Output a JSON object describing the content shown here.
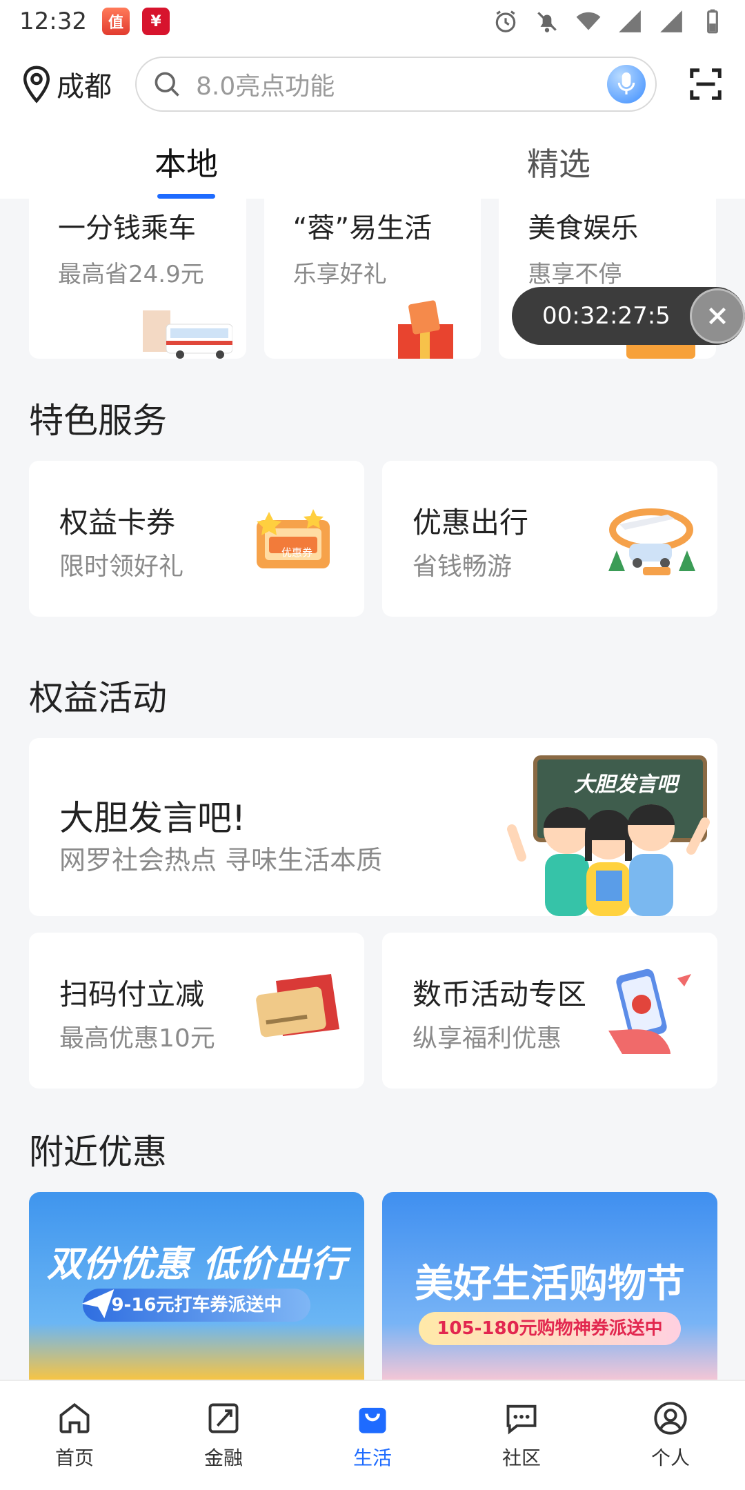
{
  "status_bar": {
    "time": "12:32",
    "app_badges": [
      "值",
      "¥"
    ]
  },
  "header": {
    "city": "成都",
    "search_placeholder": "8.0亮点功能"
  },
  "tabs": [
    {
      "label": "本地",
      "active": true
    },
    {
      "label": "精选",
      "active": false
    }
  ],
  "top_cards": [
    {
      "title": "一分钱乘车",
      "subtitle": "最高省24.9元"
    },
    {
      "title": "“蓉”易生活",
      "subtitle": "乐享好礼"
    },
    {
      "title": "美食娱乐",
      "subtitle": "惠享不停"
    }
  ],
  "timer": {
    "text": "00:32:27:5"
  },
  "special_services": {
    "title": "特色服务",
    "items": [
      {
        "title": "权益卡券",
        "subtitle": "限时领好礼",
        "art_label": "优惠券"
      },
      {
        "title": "优惠出行",
        "subtitle": "省钱畅游"
      }
    ]
  },
  "benefit_activities": {
    "title": "权益活动",
    "feature": {
      "title": "大胆发言吧!",
      "subtitle": "网罗社会热点 寻味生活本质",
      "art_label": "大胆发言吧"
    },
    "items": [
      {
        "title": "扫码付立减",
        "subtitle": "最高优惠10元"
      },
      {
        "title": "数币活动专区",
        "subtitle": "纵享福利优惠"
      }
    ]
  },
  "nearby": {
    "title": "附近优惠",
    "banners": [
      {
        "title": "双份优惠 低价出行",
        "pill": "9-16元打车券派送中"
      },
      {
        "title": "美好生活购物节",
        "pill": "105-180元购物神券派送中"
      }
    ]
  },
  "bottom_nav": [
    {
      "label": "首页",
      "icon": "home-icon",
      "active": false
    },
    {
      "label": "金融",
      "icon": "finance-icon",
      "active": false
    },
    {
      "label": "生活",
      "icon": "shopping-bag-icon",
      "active": true
    },
    {
      "label": "社区",
      "icon": "chat-icon",
      "active": false
    },
    {
      "label": "个人",
      "icon": "user-icon",
      "active": false
    }
  ],
  "colors": {
    "accent": "#1e6bff",
    "background": "#f5f6f8"
  }
}
